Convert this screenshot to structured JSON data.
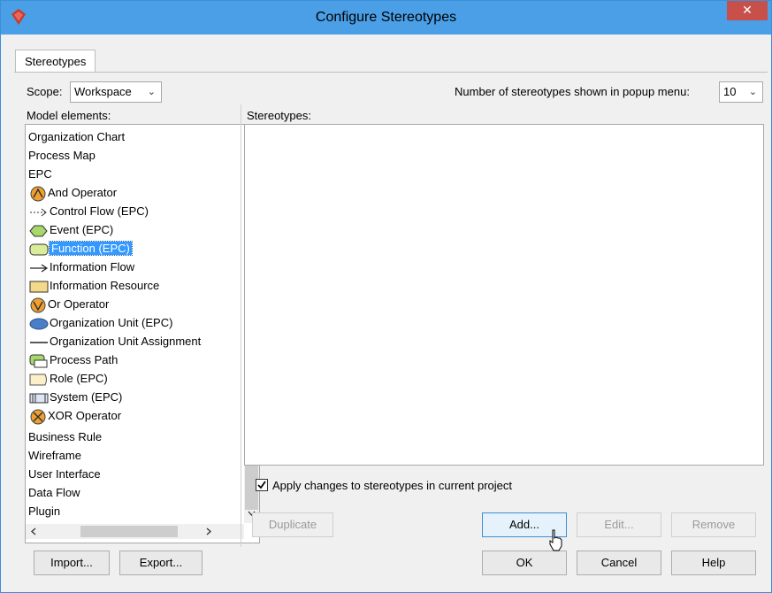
{
  "window": {
    "title": "Configure Stereotypes",
    "close_label": "✕"
  },
  "tabs": [
    {
      "label": "Stereotypes"
    }
  ],
  "scope": {
    "label": "Scope:",
    "value": "Workspace"
  },
  "popup": {
    "label": "Number of stereotypes shown in popup menu:",
    "value": "10"
  },
  "model_elements": {
    "label": "Model elements:",
    "items": [
      {
        "label": "Organization Chart",
        "icon": "none",
        "indent": 0
      },
      {
        "label": "Process Map",
        "icon": "none",
        "indent": 0
      },
      {
        "label": "EPC",
        "icon": "none",
        "indent": 0
      },
      {
        "label": "And Operator",
        "icon": "and-operator-icon",
        "indent": 1
      },
      {
        "label": "Control Flow (EPC)",
        "icon": "control-flow-icon",
        "indent": 1
      },
      {
        "label": "Event (EPC)",
        "icon": "event-icon",
        "indent": 1
      },
      {
        "label": "Function (EPC)",
        "icon": "function-icon",
        "indent": 1,
        "selected": true
      },
      {
        "label": "Information Flow",
        "icon": "information-flow-icon",
        "indent": 1
      },
      {
        "label": "Information Resource",
        "icon": "information-resource-icon",
        "indent": 1
      },
      {
        "label": "Or Operator",
        "icon": "or-operator-icon",
        "indent": 1
      },
      {
        "label": "Organization Unit (EPC)",
        "icon": "organization-unit-icon",
        "indent": 1
      },
      {
        "label": "Organization Unit Assignment",
        "icon": "assignment-line-icon",
        "indent": 1
      },
      {
        "label": "Process Path",
        "icon": "process-path-icon",
        "indent": 1
      },
      {
        "label": "Role (EPC)",
        "icon": "role-icon",
        "indent": 1
      },
      {
        "label": "System (EPC)",
        "icon": "system-icon",
        "indent": 1
      },
      {
        "label": "XOR Operator",
        "icon": "xor-operator-icon",
        "indent": 1
      },
      {
        "label": "Business Rule",
        "icon": "none",
        "indent": 0
      },
      {
        "label": "Wireframe",
        "icon": "none",
        "indent": 0
      },
      {
        "label": "User Interface",
        "icon": "none",
        "indent": 0
      },
      {
        "label": "Data Flow",
        "icon": "none",
        "indent": 0
      },
      {
        "label": "Plugin",
        "icon": "none",
        "indent": 0
      }
    ]
  },
  "stereotypes": {
    "label": "Stereotypes:"
  },
  "apply_changes": {
    "label": "Apply changes to stereotypes in current project",
    "checked": true
  },
  "buttons": {
    "duplicate": "Duplicate",
    "add": "Add...",
    "edit": "Edit...",
    "remove": "Remove",
    "import": "Import...",
    "export": "Export...",
    "ok": "OK",
    "cancel": "Cancel",
    "help": "Help"
  },
  "colors": {
    "titlebar": "#4a9fe6",
    "selection": "#3399ff",
    "operator_orange": "#f0a030",
    "app_icon_red": "#c83a2a"
  }
}
